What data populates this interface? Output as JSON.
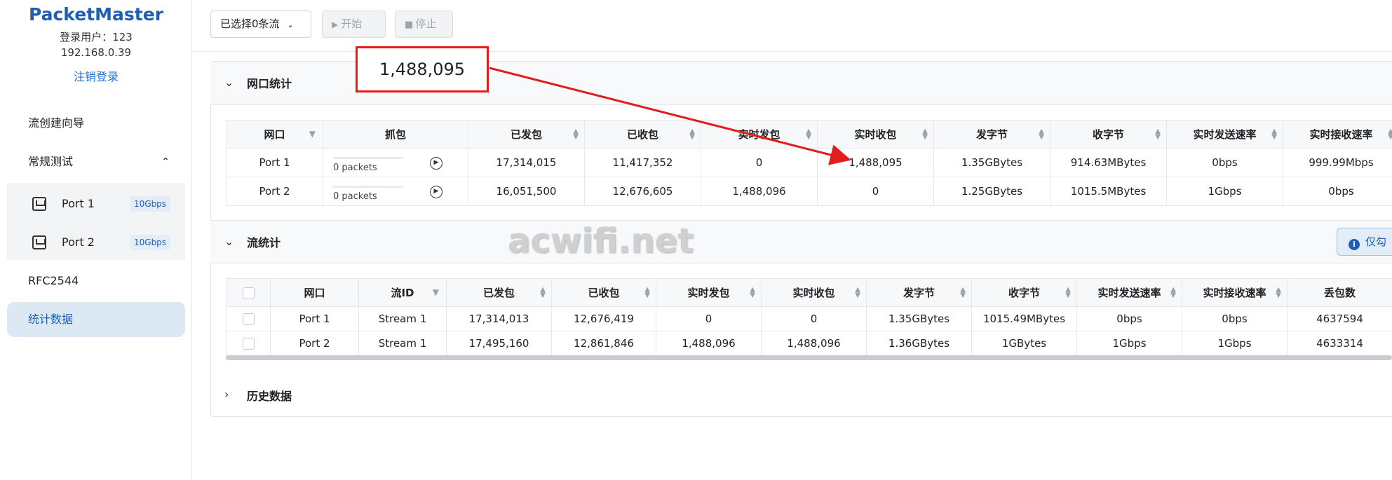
{
  "sidebar": {
    "brand": "PacketMaster",
    "user": "登录用户：123",
    "ip": "192.168.0.39",
    "logout": "注销登录",
    "nav": {
      "wizard": "流创建向导",
      "regular_test": "常规测试",
      "rfc": "RFC2544",
      "stats": "统计数据"
    },
    "ports": [
      {
        "name": "Port 1",
        "speed": "10Gbps"
      },
      {
        "name": "Port 2",
        "speed": "10Gbps"
      }
    ]
  },
  "toolbar": {
    "select_label": "已选择0条流",
    "start_label": "开始",
    "stop_label": "停止"
  },
  "port_stats": {
    "title": "网口统计",
    "headers": [
      "网口",
      "抓包",
      "已发包",
      "已收包",
      "实时发包",
      "实时收包",
      "发字节",
      "收字节",
      "实时发送速率",
      "实时接收速率"
    ],
    "rows": [
      {
        "port": "Port 1",
        "capture": "0 packets",
        "tx": "17,314,015",
        "rx": "11,417,352",
        "rt_tx": "0",
        "rt_rx": "1,488,095",
        "tx_bytes": "1.35GBytes",
        "rx_bytes": "914.63MBytes",
        "tx_rate": "0bps",
        "rx_rate": "999.99Mbps"
      },
      {
        "port": "Port 2",
        "capture": "0 packets",
        "tx": "16,051,500",
        "rx": "12,676,605",
        "rt_tx": "1,488,096",
        "rt_rx": "0",
        "tx_bytes": "1.25GBytes",
        "rx_bytes": "1015.5MBytes",
        "tx_rate": "1Gbps",
        "rx_rate": "0bps"
      }
    ]
  },
  "flow_stats": {
    "title": "流统计",
    "info_tag": "仅勾",
    "headers": [
      "网口",
      "流ID",
      "已发包",
      "已收包",
      "实时发包",
      "实时收包",
      "发字节",
      "收字节",
      "实时发送速率",
      "实时接收速率",
      "丢包数"
    ],
    "rows": [
      {
        "port": "Port 1",
        "flow_id": "Stream 1",
        "tx": "17,314,013",
        "rx": "12,676,419",
        "rt_tx": "0",
        "rt_rx": "0",
        "tx_bytes": "1.35GBytes",
        "rx_bytes": "1015.49MBytes",
        "tx_rate": "0bps",
        "rx_rate": "0bps",
        "loss": "4637594"
      },
      {
        "port": "Port 2",
        "flow_id": "Stream 1",
        "tx": "17,495,160",
        "rx": "12,861,846",
        "rt_tx": "1,488,096",
        "rt_rx": "1,488,096",
        "tx_bytes": "1.36GBytes",
        "rx_bytes": "1GBytes",
        "tx_rate": "1Gbps",
        "rx_rate": "1Gbps",
        "loss": "4633314"
      }
    ]
  },
  "history": {
    "title": "历史数据"
  },
  "annotation": {
    "callout_value": "1,488,095",
    "color": "#e31c1c"
  },
  "watermark": "acwifi.net",
  "colors": {
    "accent": "#1d5fb5",
    "active_nav_bg": "#dde8f5"
  }
}
